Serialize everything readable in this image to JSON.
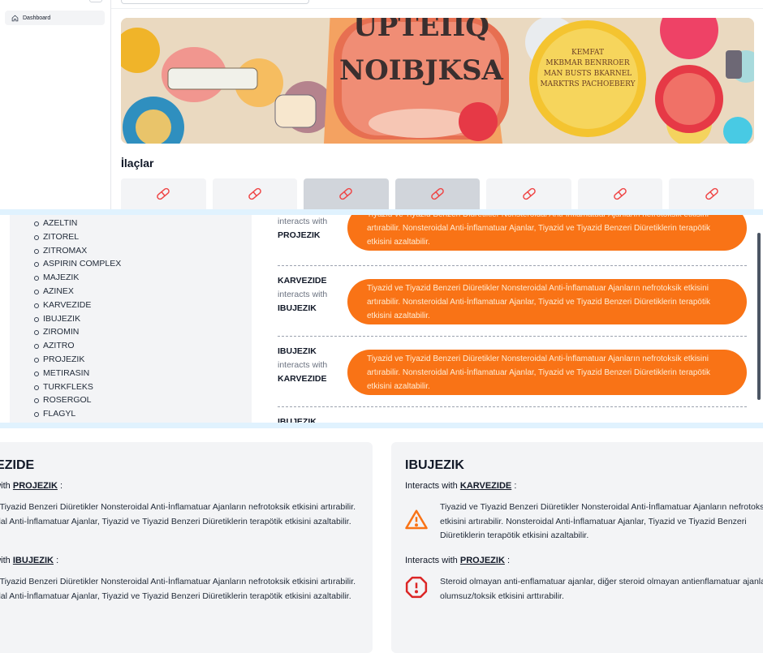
{
  "sidebar": {
    "dashboard_label": "Dashboard"
  },
  "section": {
    "drugs_heading": "İlaçlar"
  },
  "drug_list": [
    "AZELTIN",
    "ZITOREL",
    "ZITROMAX",
    "ASPIRIN COMPLEX",
    "MAJEZIK",
    "AZINEX",
    "KARVEZIDE",
    "IBUJEZIK",
    "ZIROMIN",
    "AZITRO",
    "PROJEZIK",
    "METIRASIN",
    "TURKFLEKS",
    "ROSERGOL",
    "FLAGYL"
  ],
  "interactions_panel": {
    "rows": [
      {
        "from": "",
        "mid": "interacts with",
        "to": "PROJEZIK",
        "text": "Tiyazid ve Tiyazid Benzeri Diüretikler Nonsteroidal Anti-İnflamatuar Ajanların nefrotoksik etkisini artırabilir. Nonsteroidal Anti-İnflamatuar Ajanlar, Tiyazid ve Tiyazid Benzeri Diüretiklerin terapötik etkisini azaltabilir."
      },
      {
        "from": "KARVEZIDE",
        "mid": "interacts with",
        "to": "IBUJEZIK",
        "text": "Tiyazid ve Tiyazid Benzeri Diüretikler Nonsteroidal Anti-İnflamatuar Ajanların nefrotoksik etkisini artırabilir. Nonsteroidal Anti-İnflamatuar Ajanlar, Tiyazid ve Tiyazid Benzeri Diüretiklerin terapötik etkisini azaltabilir."
      },
      {
        "from": "IBUJEZIK",
        "mid": "interacts with",
        "to": "KARVEZIDE",
        "text": "Tiyazid ve Tiyazid Benzeri Diüretikler Nonsteroidal Anti-İnflamatuar Ajanların nefrotoksik etkisini artırabilir. Nonsteroidal Anti-İnflamatuar Ajanlar, Tiyazid ve Tiyazid Benzeri Diüretiklerin terapötik etkisini azaltabilir."
      },
      {
        "from": "IBUJEZIK",
        "mid": "",
        "to": "",
        "text": ""
      }
    ]
  },
  "card_left": {
    "title": "KARVEZIDE",
    "interactions": [
      {
        "prefix": "Interacts with",
        "drug": "PROJEZIK",
        "suffix": ":",
        "text": "Tiyazid ve Tiyazid Benzeri Diüretikler Nonsteroidal Anti-İnflamatuar Ajanların nefrotoksik etkisini artırabilir. Nonsteroidal Anti-İnflamatuar Ajanlar, Tiyazid ve Tiyazid Benzeri Diüretiklerin terapötik etkisini azaltabilir."
      },
      {
        "prefix": "Interacts with",
        "drug": "IBUJEZIK",
        "suffix": ":",
        "text": "Tiyazid ve Tiyazid Benzeri Diüretikler Nonsteroidal Anti-İnflamatuar Ajanların nefrotoksik etkisini artırabilir. Nonsteroidal Anti-İnflamatuar Ajanlar, Tiyazid ve Tiyazid Benzeri Diüretiklerin terapötik etkisini azaltabilir."
      }
    ]
  },
  "card_right": {
    "title": "IBUJEZIK",
    "interactions": [
      {
        "prefix": "Interacts with",
        "drug": "KARVEZIDE",
        "suffix": ":",
        "icon": "warning-triangle-icon",
        "text": "Tiyazid ve Tiyazid Benzeri Diüretikler Nonsteroidal Anti-İnflamatuar Ajanların nefrotoksik etkisini artırabilir. Nonsteroidal Anti-İnflamatuar Ajanlar, Tiyazid ve Tiyazid Benzeri Diüretiklerin terapötik etkisini azaltabilir."
      },
      {
        "prefix": "Interacts with",
        "drug": "PROJEZIK",
        "suffix": ":",
        "icon": "alert-octagon-icon",
        "text": "Steroid olmayan anti-enflamatuar ajanlar, diğer steroid olmayan antienflamatuar ajanların olumsuz/toksik etkisini arttırabilir."
      }
    ]
  },
  "colors": {
    "accent_orange": "#f97316",
    "danger_red": "#dc2626",
    "card_bg": "#f3f4f6"
  },
  "icons": {
    "home": "home-icon",
    "pill": "pill-icon"
  }
}
